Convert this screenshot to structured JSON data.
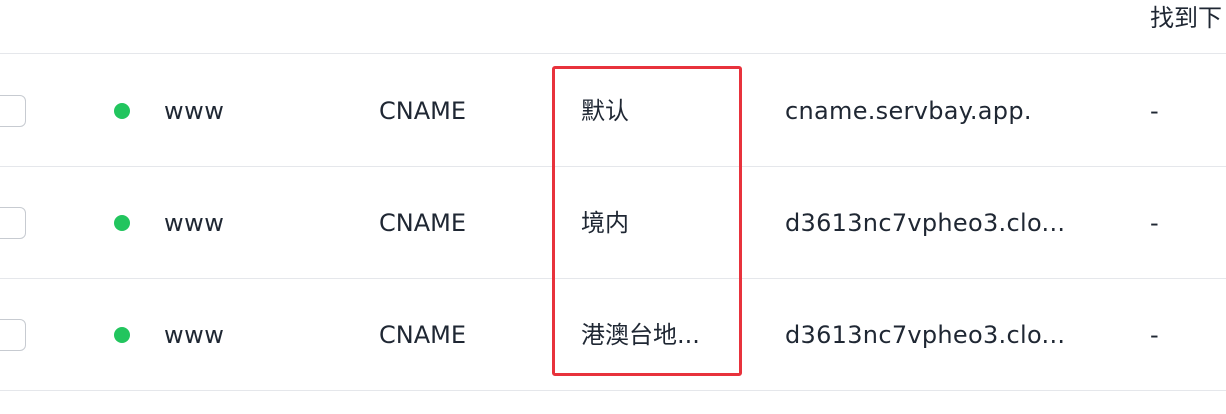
{
  "header": {
    "partial_text": "找到下"
  },
  "colors": {
    "status_dot": "#22c55e",
    "highlight": "#e8323c"
  },
  "records": [
    {
      "host": "www",
      "type": "CNAME",
      "line": "默认",
      "value": "cname.servbay.app.",
      "extra": "-"
    },
    {
      "host": "www",
      "type": "CNAME",
      "line": "境内",
      "value": "d3613nc7vpheo3.clo...",
      "extra": "-"
    },
    {
      "host": "www",
      "type": "CNAME",
      "line": "港澳台地...",
      "value": "d3613nc7vpheo3.clo...",
      "extra": "-"
    }
  ]
}
